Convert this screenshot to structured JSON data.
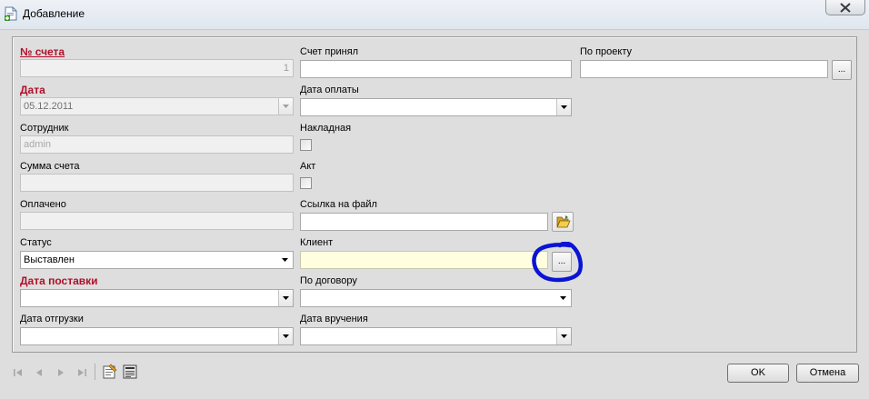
{
  "window": {
    "title": "Добавление"
  },
  "form": {
    "col1": {
      "invoice_no_label": "№ счета",
      "invoice_no_value": "1",
      "date_label": "Дата",
      "date_value": "05.12.2011",
      "employee_label": "Сотрудник",
      "employee_value": "admin",
      "amount_label": "Сумма счета",
      "amount_value": "",
      "paid_label": "Оплачено",
      "paid_value": "",
      "status_label": "Статус",
      "status_value": "Выставлен",
      "delivery_date_label": "Дата поставки",
      "delivery_date_value": "",
      "shipment_date_label": "Дата отгрузки",
      "shipment_date_value": ""
    },
    "col2": {
      "accepted_by_label": "Счет принял",
      "accepted_by_value": "",
      "payment_date_label": "Дата оплаты",
      "payment_date_value": "",
      "waybill_label": "Накладная",
      "waybill_checked": false,
      "act_label": "Акт",
      "act_checked": false,
      "file_link_label": "Ссылка на файл",
      "file_link_value": "",
      "client_label": "Клиент",
      "client_value": "",
      "contract_label": "По договору",
      "contract_value": "",
      "handover_date_label": "Дата вручения",
      "handover_date_value": ""
    },
    "col3": {
      "project_label": "По проекту",
      "project_value": ""
    },
    "browse_label": "..."
  },
  "footer": {
    "ok_label": "OK",
    "cancel_label": "Отмена"
  },
  "colors": {
    "required_label": "#b0102a",
    "client_field_bg": "#ffffe0",
    "annotation_circle": "#0a14d4"
  }
}
